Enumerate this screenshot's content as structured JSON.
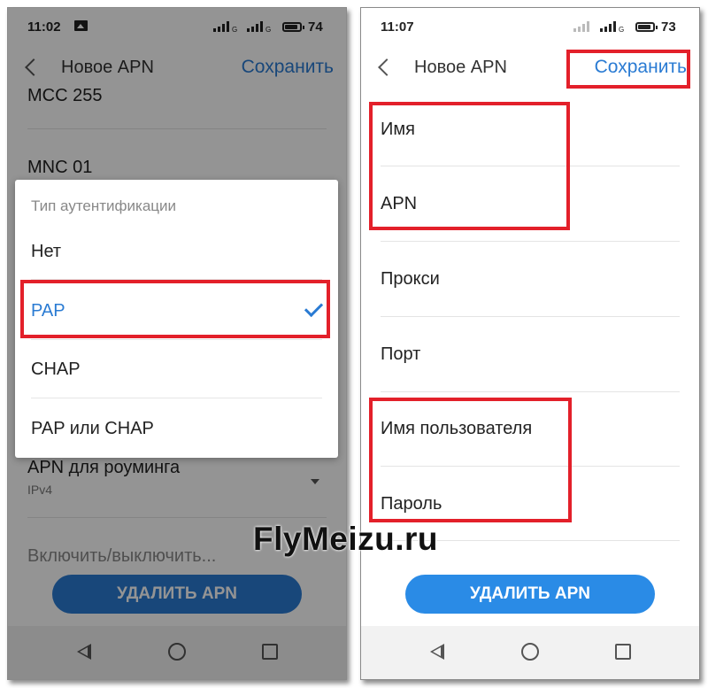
{
  "watermark": "FlyMeizu.ru",
  "colors": {
    "accent": "#2a7bd3",
    "highlight": "#e3202a",
    "disabled_button": "#1c5f9e"
  },
  "left": {
    "status": {
      "time": "11:02",
      "battery": "74",
      "signal_tag": "G"
    },
    "header": {
      "back_icon": "chevron-left-icon",
      "title": "Новое APN",
      "save": "Сохранить"
    },
    "fields": {
      "mcc": "MCC 255",
      "mnc": "MNC 01",
      "roaming_label": "APN для роуминга",
      "roaming_value": "IPv4",
      "toggle_label": "Включить/выключить..."
    },
    "dialog": {
      "title": "Тип аутентификации",
      "options": [
        "Нет",
        "PAP",
        "CHAP",
        "PAP или CHAP"
      ],
      "selected": "PAP"
    },
    "delete_button": "УДАЛИТЬ APN"
  },
  "right": {
    "status": {
      "time": "11:07",
      "battery": "73",
      "signal_tag": "G"
    },
    "header": {
      "back_icon": "chevron-left-icon",
      "title": "Новое APN",
      "save": "Сохранить"
    },
    "fields": [
      "Имя",
      "APN",
      "Прокси",
      "Порт",
      "Имя пользователя",
      "Пароль"
    ],
    "delete_button": "УДАЛИТЬ APN"
  },
  "navbar": {
    "icons": [
      "triangle-back-icon",
      "circle-home-icon",
      "square-recents-icon"
    ]
  }
}
